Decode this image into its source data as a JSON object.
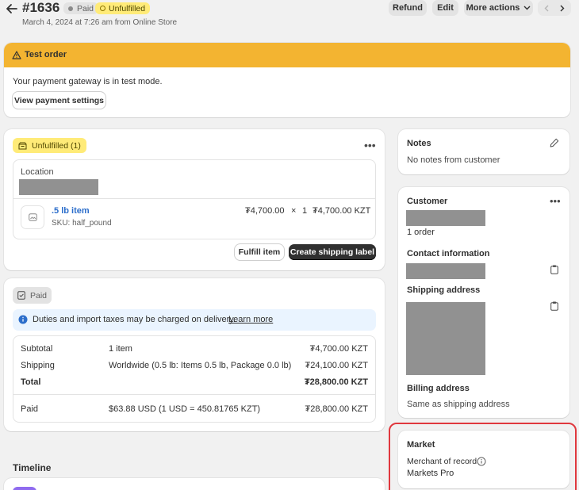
{
  "header": {
    "order_number": "#1636",
    "paid_badge": "Paid",
    "unfulfilled_badge": "Unfulfilled",
    "subtitle": "March 4, 2024 at 7:26 am from Online Store",
    "refund_label": "Refund",
    "edit_label": "Edit",
    "more_actions_label": "More actions"
  },
  "banner": {
    "title": "Test order",
    "message": "Your payment gateway is in test mode.",
    "button_label": "View payment settings"
  },
  "fulfillment": {
    "badge": "Unfulfilled (1)",
    "location_label": "Location",
    "item_name": ".5 lb item",
    "sku": "SKU: half_pound",
    "unit_price": "₮4,700.00",
    "times": "×",
    "quantity": "1",
    "line_total": "₮4,700.00 KZT",
    "fulfill_button": "Fulfill item",
    "shipping_label_button": "Create shipping label"
  },
  "payment": {
    "badge": "Paid",
    "notice": "Duties and import taxes may be charged on delivery.",
    "learn_more": "Learn more",
    "rows": [
      {
        "label": "Subtotal",
        "detail": "1 item",
        "amount": "₮4,700.00 KZT"
      },
      {
        "label": "Shipping",
        "detail": "Worldwide (0.5 lb: Items 0.5 lb, Package 0.0 lb)",
        "amount": "₮24,100.00 KZT"
      },
      {
        "label": "Total",
        "detail": "",
        "amount": "₮28,800.00 KZT"
      }
    ],
    "paid_row": {
      "label": "Paid",
      "detail": "$63.88 USD (1 USD = 450.81765 KZT)",
      "amount": "₮28,800.00 KZT"
    }
  },
  "timeline": {
    "title": "Timeline"
  },
  "notes": {
    "title": "Notes",
    "text": "No notes from customer"
  },
  "customer": {
    "title": "Customer",
    "orders": "1 order",
    "contact_title": "Contact information",
    "shipping_title": "Shipping address",
    "billing_title": "Billing address",
    "billing_text": "Same as shipping address"
  },
  "market": {
    "title": "Market",
    "merchant_label": "Merchant of record",
    "merchant_value": "Markets Pro"
  },
  "colors": {
    "banner": "#f3b431",
    "highlight": "#e0383e",
    "link": "#2c6ecb",
    "dark_button": "#303030"
  }
}
